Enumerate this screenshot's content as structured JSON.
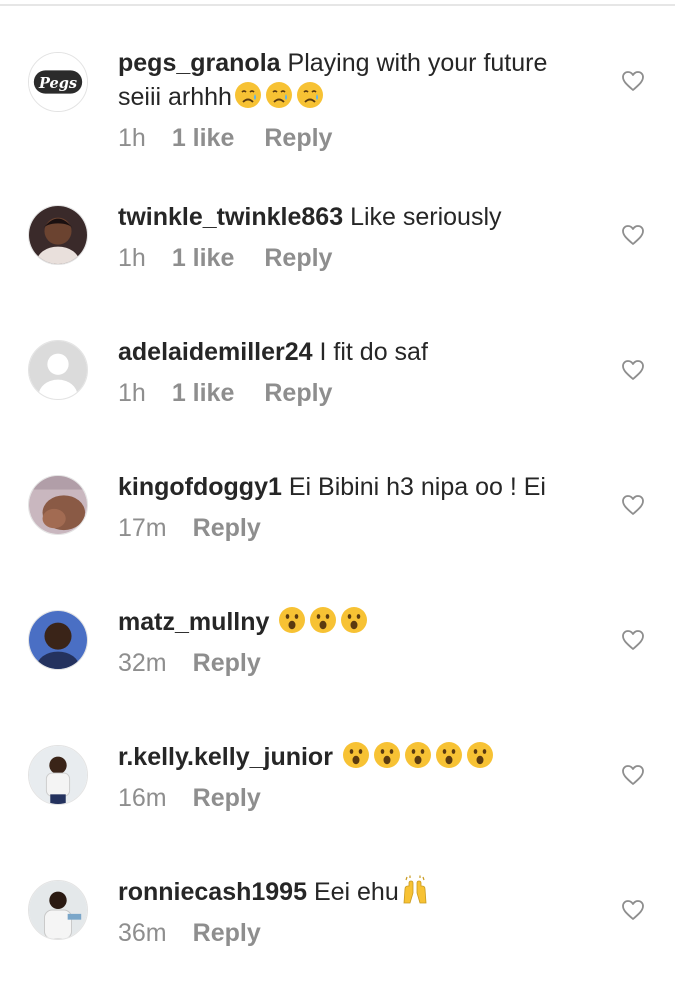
{
  "comments": [
    {
      "username": "pegs_granola",
      "text": "Playing with your future seiii arhhh",
      "emoji": [
        "crying-face",
        "crying-face",
        "crying-face"
      ],
      "time": "1h",
      "likes": "1 like",
      "reply": "Reply",
      "avatar": "avatar-pegs-logo",
      "avatar_logo_text": "Pegs"
    },
    {
      "username": "twinkle_twinkle863",
      "text": "Like seriously",
      "emoji": [],
      "time": "1h",
      "likes": "1 like",
      "reply": "Reply",
      "avatar": "avatar-photo"
    },
    {
      "username": "adelaidemiller24",
      "text": "I fit do saf",
      "emoji": [],
      "time": "1h",
      "likes": "1 like",
      "reply": "Reply",
      "avatar": "avatar-default"
    },
    {
      "username": "kingofdoggy1",
      "text": "Ei Bibini h3 nipa oo ! Ei",
      "emoji": [],
      "time": "17m",
      "likes": "",
      "reply": "Reply",
      "avatar": "avatar-photo"
    },
    {
      "username": "matz_mullny",
      "text": "",
      "emoji": [
        "astonished-face",
        "astonished-face",
        "astonished-face"
      ],
      "time": "32m",
      "likes": "",
      "reply": "Reply",
      "avatar": "avatar-photo"
    },
    {
      "username": "r.kelly.kelly_junior",
      "text": "",
      "emoji": [
        "astonished-face",
        "astonished-face",
        "astonished-face",
        "astonished-face",
        "astonished-face"
      ],
      "time": "16m",
      "likes": "",
      "reply": "Reply",
      "avatar": "avatar-photo"
    },
    {
      "username": "ronniecash1995",
      "text": "Eei ehu",
      "emoji": [
        "raising-hands"
      ],
      "time": "36m",
      "likes": "",
      "reply": "Reply",
      "avatar": "avatar-photo"
    }
  ],
  "colors": {
    "text": "#262626",
    "meta": "#8e8e8e",
    "heart_outline": "#8e8e8e",
    "divider": "#e6e6e6",
    "emoji_yellow": "#f7c234"
  }
}
